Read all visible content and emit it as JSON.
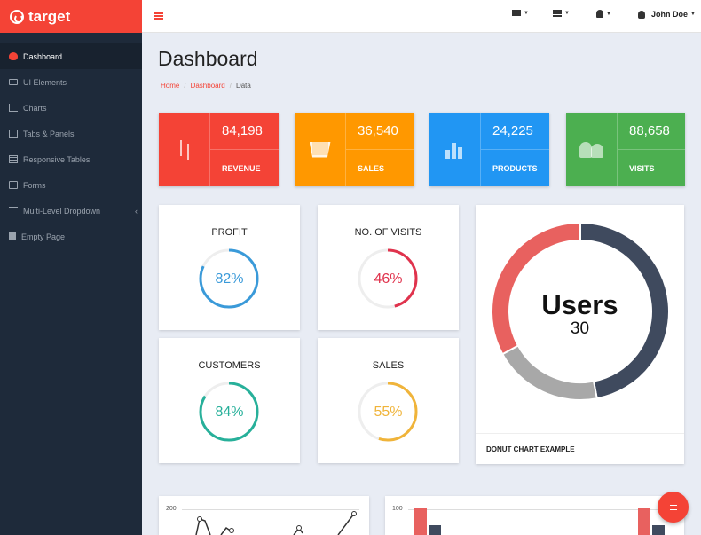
{
  "brand": {
    "name": "target"
  },
  "sidebar": {
    "items": [
      {
        "label": "Dashboard",
        "icon": "brain-icon"
      },
      {
        "label": "UI Elements",
        "icon": "monitor-icon"
      },
      {
        "label": "Charts",
        "icon": "bar-chart-icon"
      },
      {
        "label": "Tabs & Panels",
        "icon": "tabs-icon"
      },
      {
        "label": "Responsive Tables",
        "icon": "table-icon"
      },
      {
        "label": "Forms",
        "icon": "edit-icon"
      },
      {
        "label": "Multi-Level Dropdown",
        "icon": "sitemap-icon"
      },
      {
        "label": "Empty Page",
        "icon": "file-icon"
      }
    ]
  },
  "topbar": {
    "user_name": "John Doe"
  },
  "page": {
    "title": "Dashboard",
    "breadcrumb": [
      "Home",
      "Dashboard",
      "Data"
    ],
    "breadcrumb_separator": "/"
  },
  "stats": [
    {
      "value": "84,198",
      "label": "REVENUE",
      "color": "#f44336",
      "icon": "arrows-icon"
    },
    {
      "value": "36,540",
      "label": "SALES",
      "color": "#ff9800",
      "icon": "cart-icon"
    },
    {
      "value": "24,225",
      "label": "PRODUCTS",
      "color": "#2196f3",
      "icon": "bar-chart-icon"
    },
    {
      "value": "88,658",
      "label": "VISITS",
      "color": "#4caf50",
      "icon": "users-icon"
    }
  ],
  "circles": [
    {
      "title": "PROFIT",
      "percent_label": "82%",
      "percent": 82,
      "color": "#3a9ad9"
    },
    {
      "title": "NO. OF VISITS",
      "percent_label": "46%",
      "percent": 46,
      "color": "#e0334d"
    },
    {
      "title": "CUSTOMERS",
      "percent_label": "84%",
      "percent": 84,
      "color": "#27b09a"
    },
    {
      "title": "SALES",
      "percent_label": "55%",
      "percent": 55,
      "color": "#f0b43a"
    }
  ],
  "donut": {
    "title": "Users",
    "value": "30",
    "footer": "DONUT CHART EXAMPLE",
    "segments": [
      {
        "share": 0.47,
        "color": "#3f4a5e"
      },
      {
        "share": 0.2,
        "color": "#a8a8a8"
      },
      {
        "share": 0.33,
        "color": "#e8615f"
      }
    ]
  },
  "bottom_charts": {
    "line_axis_label": "200",
    "bar_axis_label": "100"
  }
}
